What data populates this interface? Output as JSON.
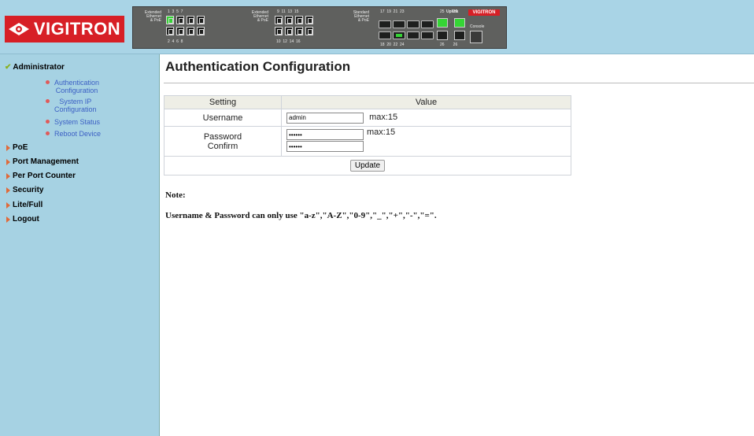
{
  "brand": {
    "logo_text": "VIGITRON",
    "panel_logo_text": "VIGITRON"
  },
  "panel": {
    "group1_label": "Extended\nEthernet\n& PoE",
    "group1_top_nums": "1  3  5  7",
    "group1_bottom_nums": "2  4  6  8",
    "group2_label": "Extended\nEthernet\n& PoE",
    "group2_top_nums": "9  11  13  15",
    "group2_bottom_nums": "10  12  14  16",
    "group3_label": "Standard\nEthernet\n& PoE",
    "group3_top_nums": "17  19  21  23",
    "group3_bottom_nums": "18  20  22  24",
    "uplink_label": "Uplink",
    "uplink_top_nums": "25        25",
    "uplink_bottom_nums": "26        26",
    "console_label": "Console",
    "active_color": "#35d435"
  },
  "sidebar": {
    "sections": [
      {
        "label": "Administrator",
        "expanded": true,
        "icon": "check-icon"
      },
      {
        "label": "PoE",
        "icon": "arrow-right-icon"
      },
      {
        "label": "Port Management",
        "icon": "arrow-right-icon"
      },
      {
        "label": "Per Port Counter",
        "icon": "arrow-right-icon"
      },
      {
        "label": "Security",
        "icon": "arrow-right-icon"
      },
      {
        "label": "Lite/Full",
        "icon": "arrow-right-icon"
      },
      {
        "label": "Logout",
        "icon": "arrow-right-icon"
      }
    ],
    "admin_items": [
      {
        "line1": "Authentication",
        "line2": "Configuration"
      },
      {
        "line1": "System IP",
        "line2": "Configuration"
      },
      {
        "line1": "System Status",
        "line2": ""
      },
      {
        "line1": "Reboot Device",
        "line2": ""
      }
    ]
  },
  "main": {
    "title": "Authentication Configuration",
    "table": {
      "col_setting": "Setting",
      "col_value": "Value",
      "username_label": "Username",
      "username_value": "admin",
      "username_max": "max:15",
      "password_label": "Password",
      "confirm_label": "Confirm",
      "password_value": "••••••",
      "confirm_value": "••••••",
      "password_max": "max:15",
      "update_button": "Update"
    },
    "note_title": "Note:",
    "note_text": "Username & Password can only use \"a-z\",\"A-Z\",\"0-9\",\"_\",\"+\",\"-\",\"=\"."
  }
}
